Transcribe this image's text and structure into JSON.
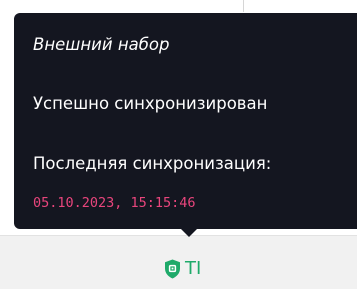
{
  "tooltip": {
    "title": "Внешний набор",
    "status": "Успешно синхронизирован",
    "last_sync_label": "Последняя синхронизация:",
    "last_sync_value": "05.10.2023, 15:15:46"
  },
  "statusbar": {
    "item_text": "TI",
    "icon": "shield-icon",
    "accent_color": "#1faa6a"
  },
  "colors": {
    "tooltip_background": "#141620",
    "timestamp_color": "#e8457c"
  }
}
